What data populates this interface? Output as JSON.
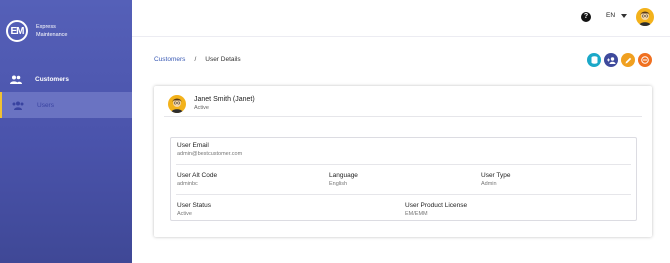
{
  "brand": {
    "name_line1": "Express",
    "name_line2": "Maintenance",
    "logo_text": "EM"
  },
  "sidebar": {
    "items": [
      {
        "label": "Customers",
        "icon": "people-icon"
      },
      {
        "label": "Users",
        "icon": "group-icon"
      }
    ]
  },
  "topbar": {
    "help_icon": "?",
    "language": "EN"
  },
  "breadcrumb": {
    "parent": "Customers",
    "separator": "/",
    "current": "User Details"
  },
  "actions": [
    {
      "icon": "database-icon",
      "color": "#1ba8c8"
    },
    {
      "icon": "add-user-icon",
      "color": "#3e4a9c"
    },
    {
      "icon": "edit-icon",
      "color": "#f0a020"
    },
    {
      "icon": "remove-icon",
      "color": "#f07020"
    }
  ],
  "user": {
    "name": "Janet Smith (Janet)",
    "status": "Active"
  },
  "fields": {
    "email_label": "User Email",
    "email_value": "admin@bestcustomer.com",
    "alt_code_label": "User Alt Code",
    "alt_code_value": "adminbc",
    "language_label": "Language",
    "language_value": "English",
    "type_label": "User Type",
    "type_value": "Admin",
    "status_label": "User Status",
    "status_value": "Active",
    "license_label": "User Product License",
    "license_value": "EM/EMM"
  }
}
